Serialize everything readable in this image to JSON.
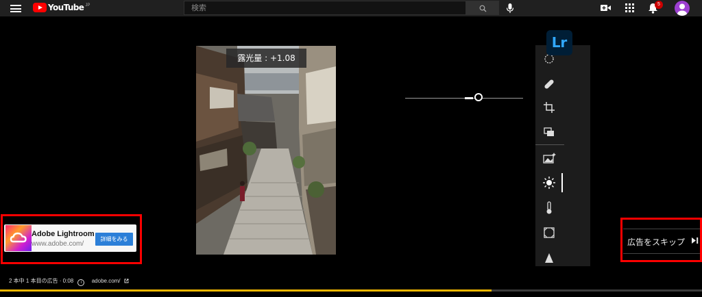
{
  "header": {
    "logo_text": "YouTube",
    "country_code": "JP",
    "search_placeholder": "検索",
    "notification_count": "5",
    "icons": [
      "menu-icon",
      "youtube-logo",
      "search-icon",
      "mic-icon",
      "video-create-icon",
      "apps-icon",
      "bell-icon",
      "avatar"
    ]
  },
  "video": {
    "exposure_label": "露光量 : +1.08",
    "lightroom_logo": "Lr",
    "tools": [
      "radial-mask-icon",
      "healing-brush-icon",
      "crop-rotate-icon",
      "versions-icon",
      "presets-icon",
      "light-icon",
      "color-temperature-icon",
      "geometry-icon",
      "detail-icon"
    ]
  },
  "ad": {
    "title": "Adobe Lightroom",
    "url": "www.adobe.com/",
    "cta_label": "詳細をみる",
    "skip_label": "広告をスキップ",
    "info_text": "2 本中 1 本目の広告 · 0:08",
    "info_icon": "i",
    "domain": "adobe.com/",
    "progress": 0.7
  },
  "colors": {
    "accent_red": "#ff0000",
    "progress_yellow": "#f3b700",
    "cta_blue": "#2b7fd8",
    "lightroom_blue": "#31a8ff"
  }
}
